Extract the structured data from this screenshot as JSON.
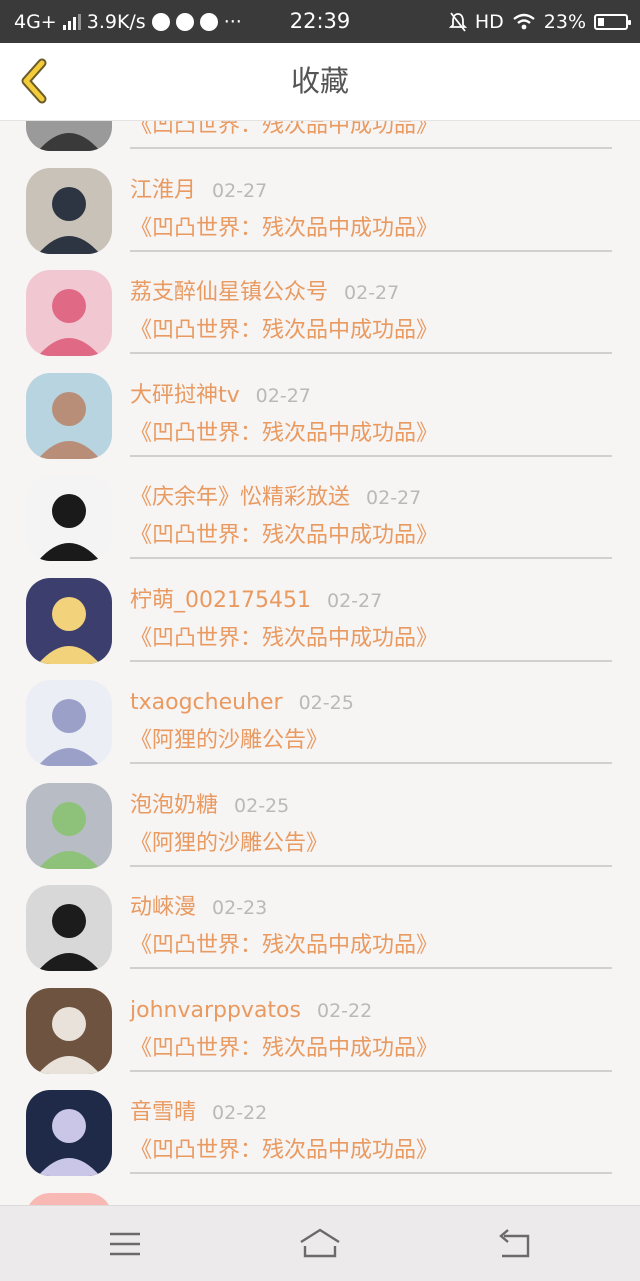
{
  "status_bar": {
    "network": "4G+",
    "speed": "3.9K/s",
    "dots": "···",
    "time": "22:39",
    "hd": "HD",
    "battery": "23%",
    "battery_level": 0.23
  },
  "header": {
    "title": "收藏",
    "back_icon": "chevron-left-icon"
  },
  "favorites": [
    {
      "name": "",
      "date": "",
      "title": "《凹凸世界：残次品中成功品》",
      "avatar_colors": [
        "#9a9a9a",
        "#3a3a3a"
      ]
    },
    {
      "name": "江淮月",
      "date": "02-27",
      "title": "《凹凸世界：残次品中成功品》",
      "avatar_colors": [
        "#c9c2b8",
        "#2d3442"
      ]
    },
    {
      "name": "荔支醉仙星镇公众号",
      "date": "02-27",
      "title": "《凹凸世界：残次品中成功品》",
      "avatar_colors": [
        "#f1c8d2",
        "#e06a86"
      ]
    },
    {
      "name": "大砰挝神tv",
      "date": "02-27",
      "title": "《凹凸世界：残次品中成功品》",
      "avatar_colors": [
        "#b7d4e0",
        "#b88e78"
      ]
    },
    {
      "name": "《庆余年》忪精彩放送",
      "date": "02-27",
      "title": "《凹凸世界：残次品中成功品》",
      "avatar_colors": [
        "#f4f4f4",
        "#1a1a1a"
      ]
    },
    {
      "name": "柠萌_002175451",
      "date": "02-27",
      "title": "《凹凸世界：残次品中成功品》",
      "avatar_colors": [
        "#3c3f6e",
        "#f2d27a"
      ]
    },
    {
      "name": "txaogcheuher",
      "date": "02-25",
      "title": "《阿狸的沙雕公告》",
      "avatar_colors": [
        "#eceef6",
        "#9aa0c8"
      ]
    },
    {
      "name": "泡泡奶糖",
      "date": "02-25",
      "title": "《阿狸的沙雕公告》",
      "avatar_colors": [
        "#b8bcc4",
        "#8ec27a"
      ]
    },
    {
      "name": "动崍漫",
      "date": "02-23",
      "title": "《凹凸世界：残次品中成功品》",
      "avatar_colors": [
        "#d8d8d8",
        "#1c1c1c"
      ]
    },
    {
      "name": "johnvarppvatos",
      "date": "02-22",
      "title": "《凹凸世界：残次品中成功品》",
      "avatar_colors": [
        "#6e5440",
        "#e8e2da"
      ]
    },
    {
      "name": "音雪晴",
      "date": "02-22",
      "title": "《凹凸世界：残次品中成功品》",
      "avatar_colors": [
        "#1f2a48",
        "#c9c6e8"
      ]
    },
    {
      "name": "",
      "date": "",
      "title": "",
      "avatar_colors": [
        "#f8b9b5",
        "#e87c7c"
      ]
    }
  ],
  "nav": {
    "menu_icon": "menu-icon",
    "home_icon": "home-icon",
    "back_icon": "return-icon"
  }
}
